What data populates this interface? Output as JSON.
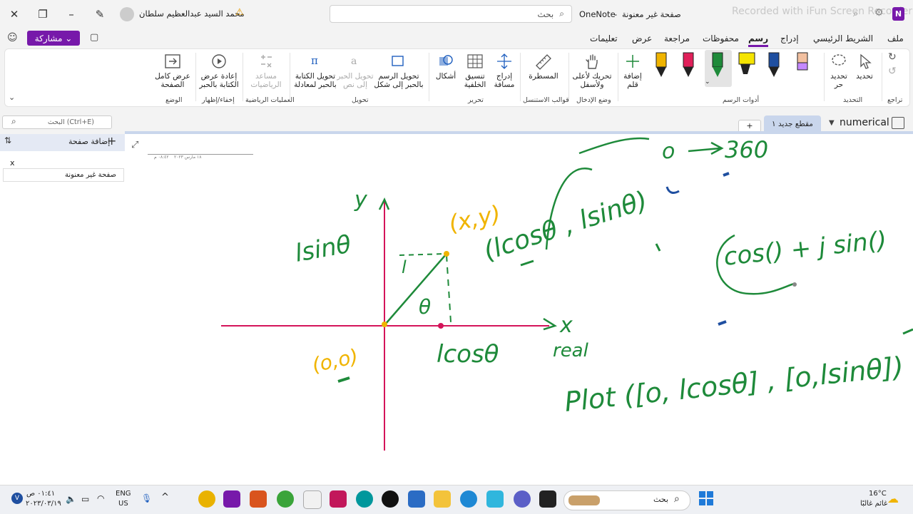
{
  "titlebar": {
    "app_name": "OneNote",
    "doc_title": "صفحة غير معنونة",
    "separator": "-",
    "search_placeholder": "بحث",
    "user_name": "محمد السيد عبدالعظيم سلطان",
    "watermark": "Recorded with iFun Screen Recorder"
  },
  "menu": {
    "tabs": [
      "ملف",
      "الشريط الرئيسي",
      "إدراج",
      "رسم",
      "محفوظات",
      "مراجعة",
      "عرض",
      "تعليمات"
    ],
    "active_tab": "رسم",
    "share_label": "مشاركة"
  },
  "ribbon": {
    "undo_group": "تراجع",
    "select_group": "التحديد",
    "select": "تحديد",
    "lasso": "تحديد حر",
    "tools_group": "أدوات الرسم",
    "add_pen": "إضافة قلم",
    "insert_group": "وضع الإدخال",
    "move_up": "تحريك لأعلى ولأسفل",
    "stencils_group": "قوالب الاستنسل",
    "ruler": "المسطرة",
    "insert_space": "إدراج مسافة",
    "edit_group": "تحرير",
    "arrange": "تنسيق الخلفية",
    "shapes": "أشكال",
    "convert_group": "تحويل",
    "ink_to_shape": "تحويل الرسم بالحبر إلى شكل",
    "ink_to_text": "تحويل الحبر إلى نص",
    "ink_to_math": "تحويل الكتابة بالحبر لمعادلة",
    "math_group": "العمليات الرياضية",
    "math_assistant": "مساعد الرياضيات",
    "replay_group": "إخفاء/إظهار",
    "ink_replay": "إعادة عرض الكتابة بالحبر",
    "view_group": "الوضع",
    "full_page": "عرض كامل الصفحة"
  },
  "nav": {
    "search_placeholder": "البحث (Ctrl+E)",
    "add_page": "إضافة صفحة",
    "page_item_x": "x",
    "page_item": "صفحة غير معنونة"
  },
  "sections": {
    "notebook": "numerical",
    "section_tab": "مقطع جديد ١",
    "add_tab": "+"
  },
  "page": {
    "date": "١٨ مارس ٢٠٢٣",
    "time": "٠٨:٤٢ م"
  },
  "ink": {
    "y_label": "y",
    "x_label": "x",
    "real_label": "real",
    "sin_label": "lsinθ",
    "cos_label": "lcosθ",
    "xy_label": "(x,y)",
    "origin_label": "(o,o)",
    "l_label": "l",
    "theta_label": "θ",
    "polar_label": "(lcosθ , lsinθ)",
    "range_from": "o",
    "range_to": "360",
    "complex_label": "cos() + j sin()",
    "plot_label": "Plot ([o, lcosθ] , [o,lsinθ])"
  },
  "taskbar": {
    "search": "بحث",
    "weather_temp": "16°C",
    "weather_text": "غائم غالبًا",
    "lang": "ENG",
    "lang2": "US",
    "time": "٠١:٤١ ص",
    "date": "٢٠٢٣/٠٣/١٩",
    "account": "V"
  },
  "colors": {
    "accent": "#7719aa",
    "axis": "#d4145a",
    "green_ink": "#1e8a3a",
    "yellow_ink": "#f0b400",
    "navy_ink": "#1f4fa0"
  }
}
